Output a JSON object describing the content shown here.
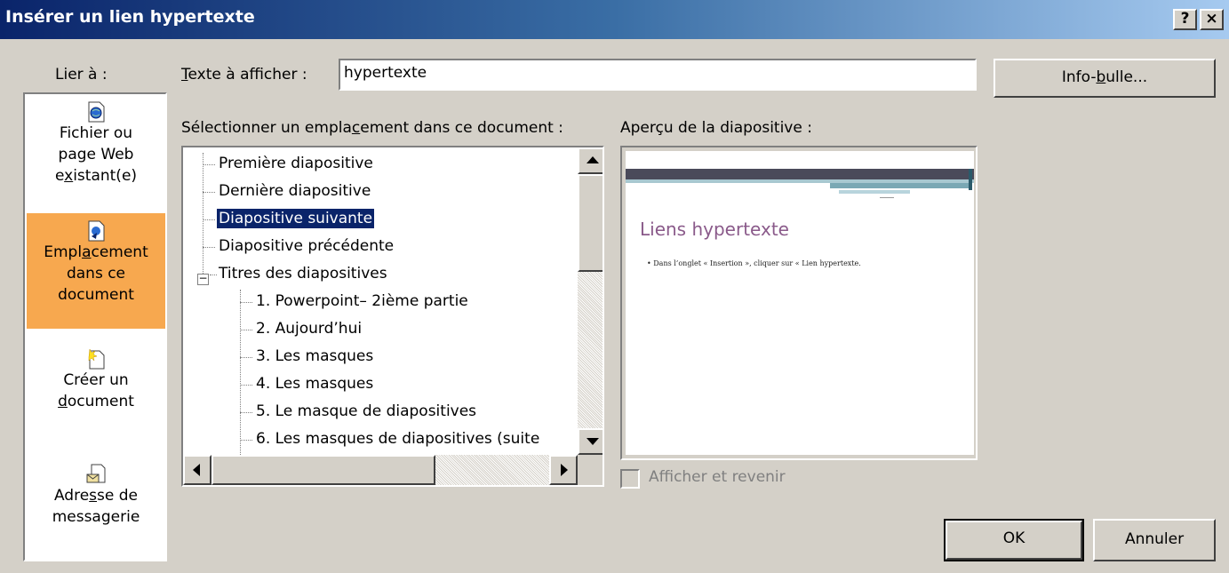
{
  "window": {
    "title": "Insérer un lien hypertexte",
    "help_button": "?",
    "close_button": "×"
  },
  "link_to": {
    "label": "Lier à :",
    "items": [
      {
        "lines": [
          "Fichier ou",
          "page Web",
          "existant(e)"
        ],
        "icon": "web-file-icon",
        "selected": false
      },
      {
        "lines": [
          "Emplacement",
          "dans ce",
          "document"
        ],
        "icon": "place-in-document-icon",
        "selected": true
      },
      {
        "lines": [
          "Créer un",
          "document"
        ],
        "icon": "new-document-icon",
        "selected": false
      },
      {
        "lines": [
          "Adresse de",
          "messagerie"
        ],
        "icon": "email-address-icon",
        "selected": false
      }
    ]
  },
  "text_to_display": {
    "label": "Texte à afficher :",
    "value": "hypertexte"
  },
  "screentip_button": "Info-bulle...",
  "select_place": {
    "label": "Sélectionner un emplacement dans ce document :",
    "items": [
      {
        "text": "Première diapositive",
        "level": 0
      },
      {
        "text": "Dernière diapositive",
        "level": 0
      },
      {
        "text": "Diapositive suivante",
        "level": 0,
        "selected": true
      },
      {
        "text": "Diapositive précédente",
        "level": 0
      },
      {
        "text": "Titres des diapositives",
        "level": 0,
        "expanded": true
      },
      {
        "text": "1. Powerpoint– 2ième partie",
        "level": 1
      },
      {
        "text": "2. Aujourd’hui",
        "level": 1
      },
      {
        "text": "3. Les masques",
        "level": 1
      },
      {
        "text": "4. Les masques",
        "level": 1
      },
      {
        "text": "5. Le masque de diapositives",
        "level": 1
      },
      {
        "text": "6. Les masques de diapositives (suite",
        "level": 1
      }
    ]
  },
  "preview": {
    "label": "Aperçu de la diapositive :",
    "slide_title": "Liens hypertexte",
    "slide_body": "• Dans l’onglet « Insertion », cliquer sur « Lien hypertexte."
  },
  "show_and_return": {
    "label": "Afficher et revenir",
    "checked": false,
    "enabled": false
  },
  "buttons": {
    "ok": "OK",
    "cancel": "Annuler"
  },
  "colors": {
    "titlebar": "#0a246a",
    "selected_link": "#f7a84f",
    "selection": "#0a246a",
    "dialog_bg": "#d4d0c8"
  }
}
